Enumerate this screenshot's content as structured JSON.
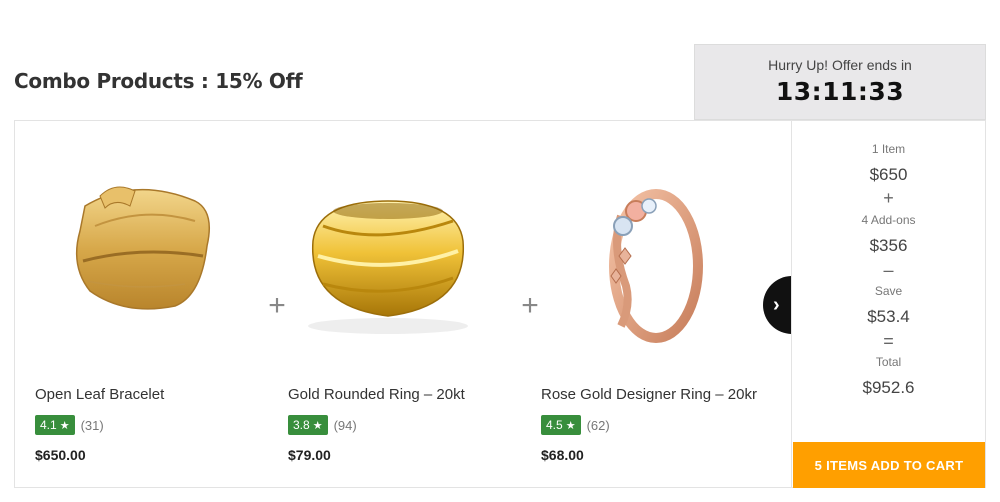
{
  "heading": "Combo Products : 15% Off",
  "timer": {
    "caption": "Hurry Up! Offer ends in",
    "value": "13:11:33"
  },
  "products": [
    {
      "name": "Open Leaf Bracelet",
      "rating": "4.1",
      "reviews": "(31)",
      "price": "$650.00",
      "icon": "bracelet-image"
    },
    {
      "name": "Gold Rounded Ring – 20kt",
      "rating": "3.8",
      "reviews": "(94)",
      "price": "$79.00",
      "icon": "gold-ring-image"
    },
    {
      "name": "Rose Gold Designer Ring – 20kr",
      "rating": "4.5",
      "reviews": "(62)",
      "price": "$68.00",
      "icon": "rose-gold-ring-image"
    }
  ],
  "symbols": {
    "plus": "+",
    "star": "★",
    "next": "›",
    "minus": "–",
    "equals": "="
  },
  "summary": {
    "items_label": "1 Item",
    "items_amount": "$650",
    "addons_label": "4 Add-ons",
    "addons_amount": "$356",
    "save_label": "Save",
    "save_amount": "$53.4",
    "total_label": "Total",
    "total_amount": "$952.6"
  },
  "cart_button": "5 ITEMS ADD TO CART",
  "colors": {
    "accent": "#ff9f00",
    "rating": "#388e3c",
    "timer_bg": "#e9e8ea"
  }
}
